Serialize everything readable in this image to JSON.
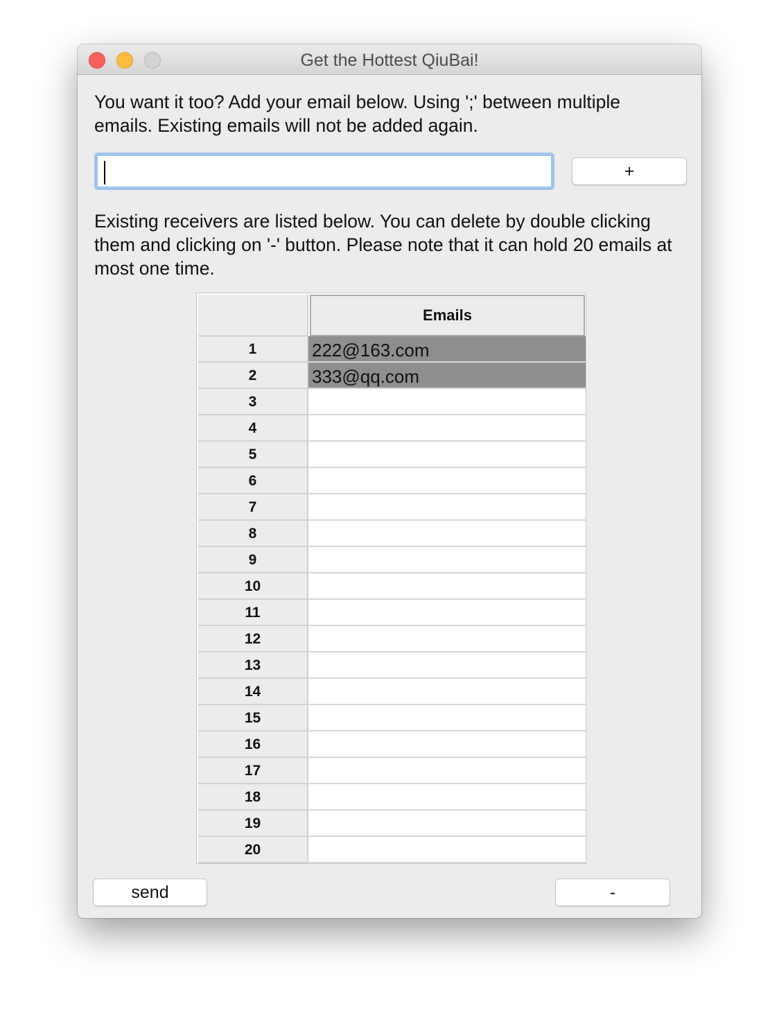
{
  "window": {
    "title": "Get the Hottest QiuBai!"
  },
  "instructions": {
    "add": "You want it too? Add your email below. Using ';' between multiple emails. Existing emails will not be added again.",
    "list": "Existing receivers are listed below. You can delete by double clicking them and clicking on '-' button. Please note that it can hold 20 emails at most one time."
  },
  "email_input": {
    "value": "",
    "placeholder": ""
  },
  "buttons": {
    "add": "+",
    "send": "send",
    "remove": "-"
  },
  "table": {
    "column_header": "Emails",
    "rows": [
      {
        "num": "1",
        "email": "222@163.com",
        "selected": true
      },
      {
        "num": "2",
        "email": "333@qq.com",
        "selected": true
      },
      {
        "num": "3",
        "email": "",
        "selected": false
      },
      {
        "num": "4",
        "email": "",
        "selected": false
      },
      {
        "num": "5",
        "email": "",
        "selected": false
      },
      {
        "num": "6",
        "email": "",
        "selected": false
      },
      {
        "num": "7",
        "email": "",
        "selected": false
      },
      {
        "num": "8",
        "email": "",
        "selected": false
      },
      {
        "num": "9",
        "email": "",
        "selected": false
      },
      {
        "num": "10",
        "email": "",
        "selected": false
      },
      {
        "num": "11",
        "email": "",
        "selected": false
      },
      {
        "num": "12",
        "email": "",
        "selected": false
      },
      {
        "num": "13",
        "email": "",
        "selected": false
      },
      {
        "num": "14",
        "email": "",
        "selected": false
      },
      {
        "num": "15",
        "email": "",
        "selected": false
      },
      {
        "num": "16",
        "email": "",
        "selected": false
      },
      {
        "num": "17",
        "email": "",
        "selected": false
      },
      {
        "num": "18",
        "email": "",
        "selected": false
      },
      {
        "num": "19",
        "email": "",
        "selected": false
      },
      {
        "num": "20",
        "email": "",
        "selected": false
      }
    ]
  },
  "colors": {
    "selection": "#8e8e8e",
    "focus_ring": "#9fc4ec",
    "close_light": "#fc605c",
    "minimize_light": "#fdbc40",
    "zoom_light": "#d3d3d3"
  }
}
